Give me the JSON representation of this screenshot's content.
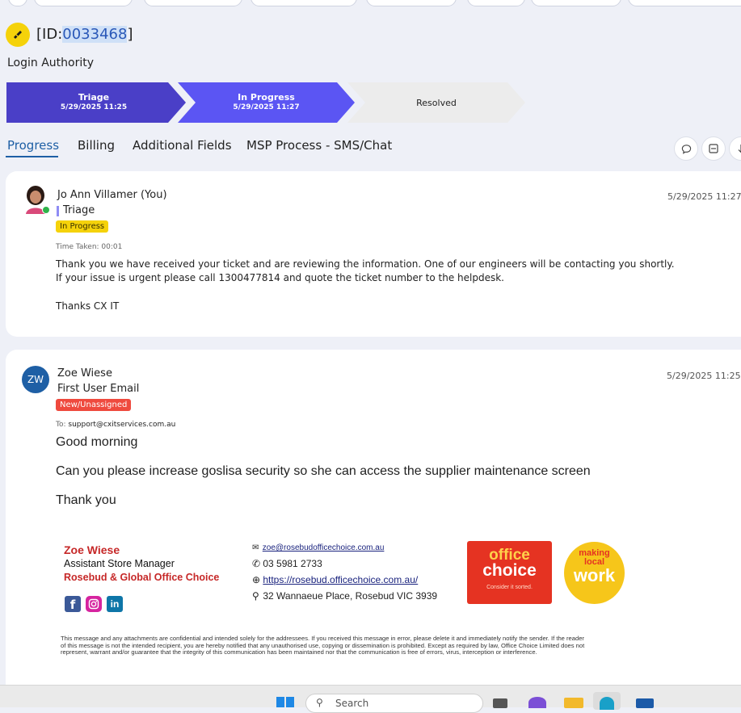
{
  "ticket": {
    "id_prefix": "[ID:",
    "id_number": "0033468",
    "id_suffix": "]",
    "subject": "Login Authority"
  },
  "stages": [
    {
      "label": "Triage",
      "date": "5/29/2025 11:25"
    },
    {
      "label": "In Progress",
      "date": "5/29/2025 11:27"
    },
    {
      "label": "Resolved",
      "date": ""
    }
  ],
  "tabs": [
    "Progress",
    "Billing",
    "Additional Fields",
    "MSP Process - SMS/Chat"
  ],
  "entries": [
    {
      "author": "Jo Ann Villamer (You)",
      "stage": "Triage",
      "status": "In Progress",
      "timestamp": "5/29/2025 11:27",
      "time_taken": "Time Taken: 00:01",
      "lines": [
        "Thank you we have received your ticket and are reviewing the information. One of our engineers will be contacting you shortly.",
        "If your issue is urgent please call 1300477814 and quote the ticket number to the helpdesk.",
        "Thanks CX IT"
      ]
    },
    {
      "initials": "ZW",
      "author": "Zoe Wiese",
      "subtitle": "First User Email",
      "status": "New/Unassigned",
      "timestamp": "5/29/2025 11:25",
      "to_label": "To:",
      "to": "support@cxitservices.com.au",
      "lines": [
        "Good morning",
        "Can you please increase goslisa security so she can access the supplier maintenance screen",
        "Thank you"
      ]
    }
  ],
  "signature": {
    "name": "Zoe Wiese",
    "title": "Assistant Store Manager",
    "store": "Rosebud & Global Office Choice",
    "email": "zoe@rosebudofficechoice.com.au",
    "phone": "03 5981 2733",
    "website": "https://rosebud.officechoice.com.au/",
    "address": "32 Wannaeue Place, Rosebud VIC 3939",
    "logo1_line1": "office",
    "logo1_line2": "choice",
    "logo1_tag": "Consider it sorted.",
    "logo2_line1": "making",
    "logo2_line2": "local",
    "logo2_line3": "work",
    "disclaimer": "This message and any attachments are confidential and intended solely for the addressees. If you received this message in error, please delete it and immediately notify the sender. If the reader of this message is not the intended recipient, you are hereby notified that any unauthorised use, copying or dissemination is prohibited. Except as required by law, Office Choice Limited does not represent, warrant and/or guarantee that the integrity of this communication has been maintained nor that the communication is free of errors, virus, interception or interference."
  },
  "taskbar": {
    "search_placeholder": "Search"
  },
  "colors": {
    "primary": "#1e5fa5",
    "stage_done": "#4a3fc7",
    "stage_active": "#5b55f3",
    "badge_yellow": "#f5d20a",
    "badge_red": "#ef4a3e",
    "brand_red": "#c62828"
  }
}
